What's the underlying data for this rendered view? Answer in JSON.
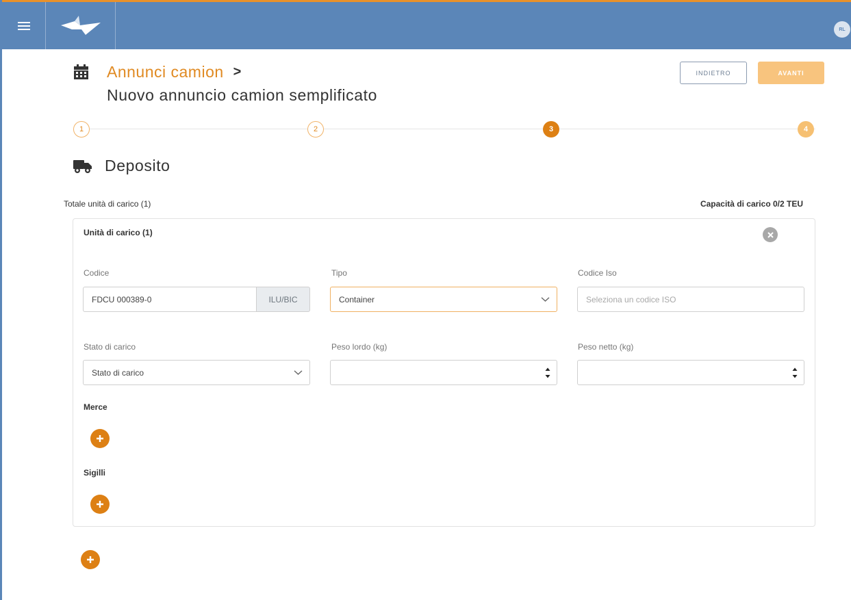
{
  "topbar": {
    "avatar_text": "RL",
    "accent_color": "#5b86b8",
    "top_border_color": "#e8912b"
  },
  "header": {
    "breadcrumb_link": "Annunci camion",
    "breadcrumb_separator": ">",
    "title": "Nuovo annuncio camion semplificato",
    "back_label": "INDIETRO",
    "next_label": "AVANTI"
  },
  "stepper": {
    "steps": [
      {
        "label": "1",
        "state": "done"
      },
      {
        "label": "2",
        "state": "done"
      },
      {
        "label": "3",
        "state": "active"
      },
      {
        "label": "4",
        "state": "todo"
      }
    ]
  },
  "section": {
    "title": "Deposito",
    "icon": "truck-icon",
    "total_units": "Totale unità di carico (1)",
    "capacity": "Capacità di carico 0/2 TEU"
  },
  "card": {
    "title": "Unità di carico (1)",
    "fields": {
      "codice": {
        "label": "Codice",
        "value": "FDCU 000389-0",
        "addon": "ILU/BIC"
      },
      "tipo": {
        "label": "Tipo",
        "value": "Container"
      },
      "codice_iso": {
        "label": "Codice Iso",
        "placeholder": "Seleziona un codice ISO"
      },
      "stato_carico": {
        "label": "Stato di carico",
        "value": "Stato di carico"
      },
      "peso_lordo": {
        "label": "Peso lordo (kg)",
        "value": ""
      },
      "peso_netto": {
        "label": "Peso netto (kg)",
        "value": ""
      }
    },
    "merce_label": "Merce",
    "sigilli_label": "Sigilli"
  }
}
